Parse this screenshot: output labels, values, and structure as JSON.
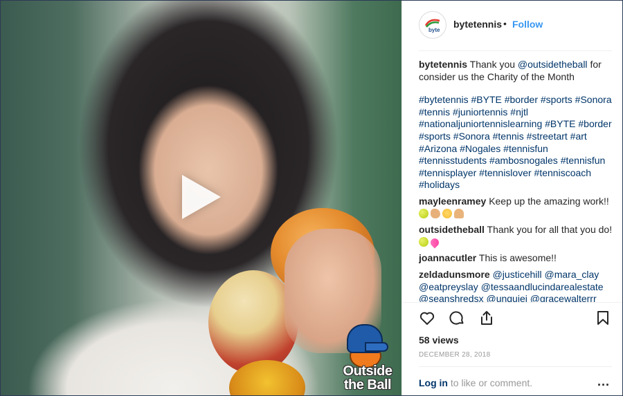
{
  "post": {
    "username": "bytetennis",
    "separator": "•",
    "follow_label": "Follow",
    "avatar_text": "byte"
  },
  "caption": {
    "username": "bytetennis",
    "text_pre": "Thank you",
    "mention": "@outsidetheball",
    "text_post": "for consider us the Charity of the Month",
    "hashtags": "#bytetennis #BYTE #border #sports #Sonora #tennis #juniortennis #njtl #nationaljuniortennislearning #BYTE #border #sports #Sonora #tennis #streetart #art #Arizona #Nogales #tennisfun #tennisstudents #ambosnogales #tennisfun #tennisplayer #tennislover #tenniscoach #holidays"
  },
  "comments": [
    {
      "username": "mayleenramey",
      "text": "Keep up the amazing work!!",
      "emojis": [
        "tennis-ball",
        "muscle",
        "smiling-face",
        "folded-hands"
      ]
    },
    {
      "username": "outsidetheball",
      "text": "Thank you for all that you do!",
      "emojis": [
        "tennis-ball",
        "two-hearts"
      ]
    },
    {
      "username": "joannacutler",
      "text": "This is awesome!!"
    },
    {
      "username": "zeldadunsmore",
      "text": "@justicehill @mara_clay @eatpreyslay @tessaandlucindarealestate @seanshredsx @unquiei @gracewalterrr"
    }
  ],
  "media": {
    "watermark_line1": "Outside",
    "watermark_line2": "the Ball"
  },
  "actions": {
    "icons": [
      "heart-icon",
      "comment-icon",
      "share-icon",
      "bookmark-icon"
    ],
    "views": "58 views",
    "date": "DECEMBER 28, 2018",
    "login_link": "Log in",
    "login_rest": "to like or comment.",
    "more": "..."
  },
  "colors": {
    "link_blue": "#3897f0",
    "mention_blue": "#003569",
    "text": "#262626",
    "muted": "#999999"
  }
}
